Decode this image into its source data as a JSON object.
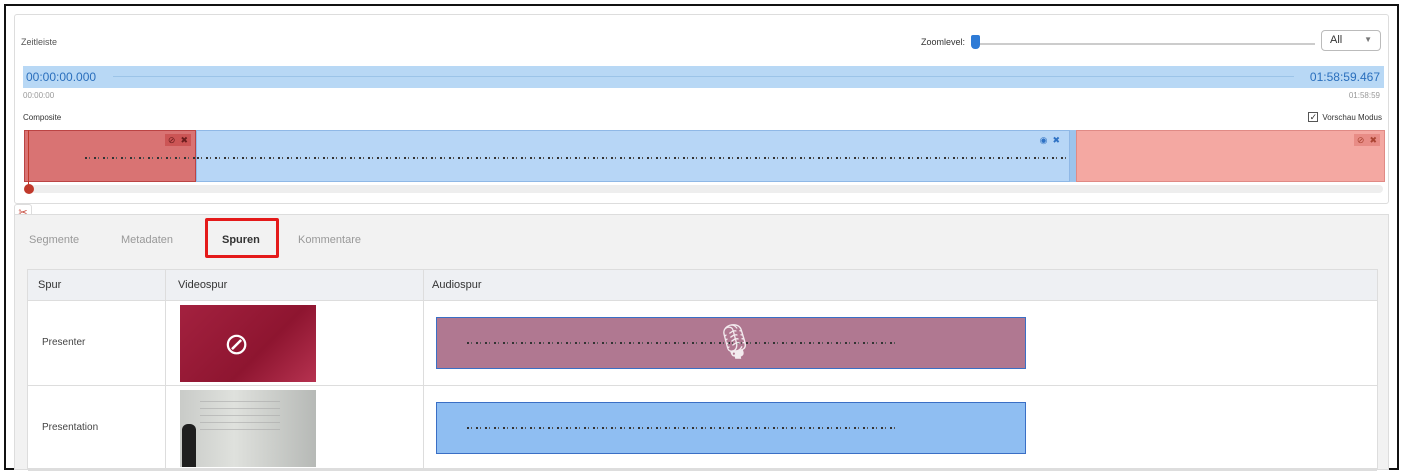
{
  "timeline": {
    "title": "Zeitleiste",
    "zoom_label": "Zoomlevel:",
    "zoom_select": "All",
    "time_start": "00:00:00.000",
    "time_end": "01:58:59.467",
    "time_start_small": "00:00:00",
    "time_end_small": "01:58:59",
    "composite_label": "Composite",
    "preview_mode_label": "Vorschau Modus",
    "preview_mode_checked": "✓"
  },
  "tabs": [
    "Segmente",
    "Metadaten",
    "Spuren",
    "Kommentare"
  ],
  "table": {
    "headers": [
      "Spur",
      "Videospur",
      "Audiospur"
    ],
    "rows": [
      {
        "name": "Presenter"
      },
      {
        "name": "Presentation"
      }
    ]
  },
  "colors": {
    "accent": "#2e7bd6",
    "highlight": "#e41a1a",
    "segment_deleted": "#d97373",
    "segment_active": "#b7d6f6"
  },
  "icons": {
    "hidden": "eye-slash-icon",
    "visible": "eye-icon",
    "delete": "x-icon",
    "cut": "scissors-icon",
    "mute": "mic-off-icon"
  }
}
